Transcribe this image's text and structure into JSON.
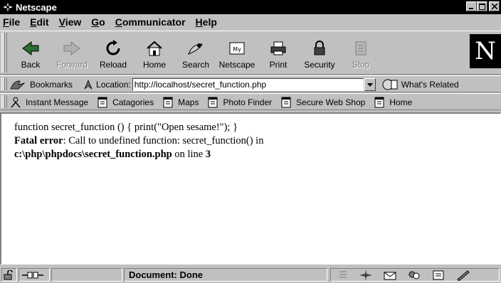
{
  "window": {
    "title": "Netscape"
  },
  "menu": [
    {
      "label": "File",
      "accel": "F",
      "rest": "ile"
    },
    {
      "label": "Edit",
      "accel": "E",
      "rest": "dit"
    },
    {
      "label": "View",
      "accel": "V",
      "rest": "iew"
    },
    {
      "label": "Go",
      "accel": "G",
      "rest": "o"
    },
    {
      "label": "Communicator",
      "accel": "C",
      "rest": "ommunicator"
    },
    {
      "label": "Help",
      "accel": "H",
      "rest": "elp"
    }
  ],
  "nav": {
    "back": "Back",
    "forward": "Forward",
    "reload": "Reload",
    "home": "Home",
    "search": "Search",
    "netscape": "Netscape",
    "print": "Print",
    "security": "Security",
    "stop": "Stop",
    "logo": "N"
  },
  "location": {
    "bookmarks_label": "Bookmarks",
    "location_label": "Location:",
    "url": "http://localhost/secret_function.php",
    "whats_related": "What's Related"
  },
  "personal_bar": {
    "items": [
      {
        "label": "Instant Message",
        "icon": "person-icon"
      },
      {
        "label": "Catagories",
        "icon": "bookmark-page-icon"
      },
      {
        "label": "Maps",
        "icon": "bookmark-page-icon"
      },
      {
        "label": "Photo Finder",
        "icon": "bookmark-page-icon"
      },
      {
        "label": "Secure Web Shop",
        "icon": "bookmark-page-icon"
      },
      {
        "label": "Home",
        "icon": "bookmark-page-icon"
      }
    ]
  },
  "content": {
    "line1": "function secret_function () { print(\"Open sesame!\"); }",
    "fatal_label": "Fatal error",
    "fatal_msg": ": Call to undefined function: secret_function() in",
    "path": "c:\\php\\phpdocs\\secret_function.php",
    "on_line": " on line ",
    "line_no": "3"
  },
  "status": {
    "text": "Document: Done"
  },
  "colors": {
    "chrome": "#c0c0c0",
    "titlebar": "#000000",
    "content_bg": "#ffffff"
  }
}
